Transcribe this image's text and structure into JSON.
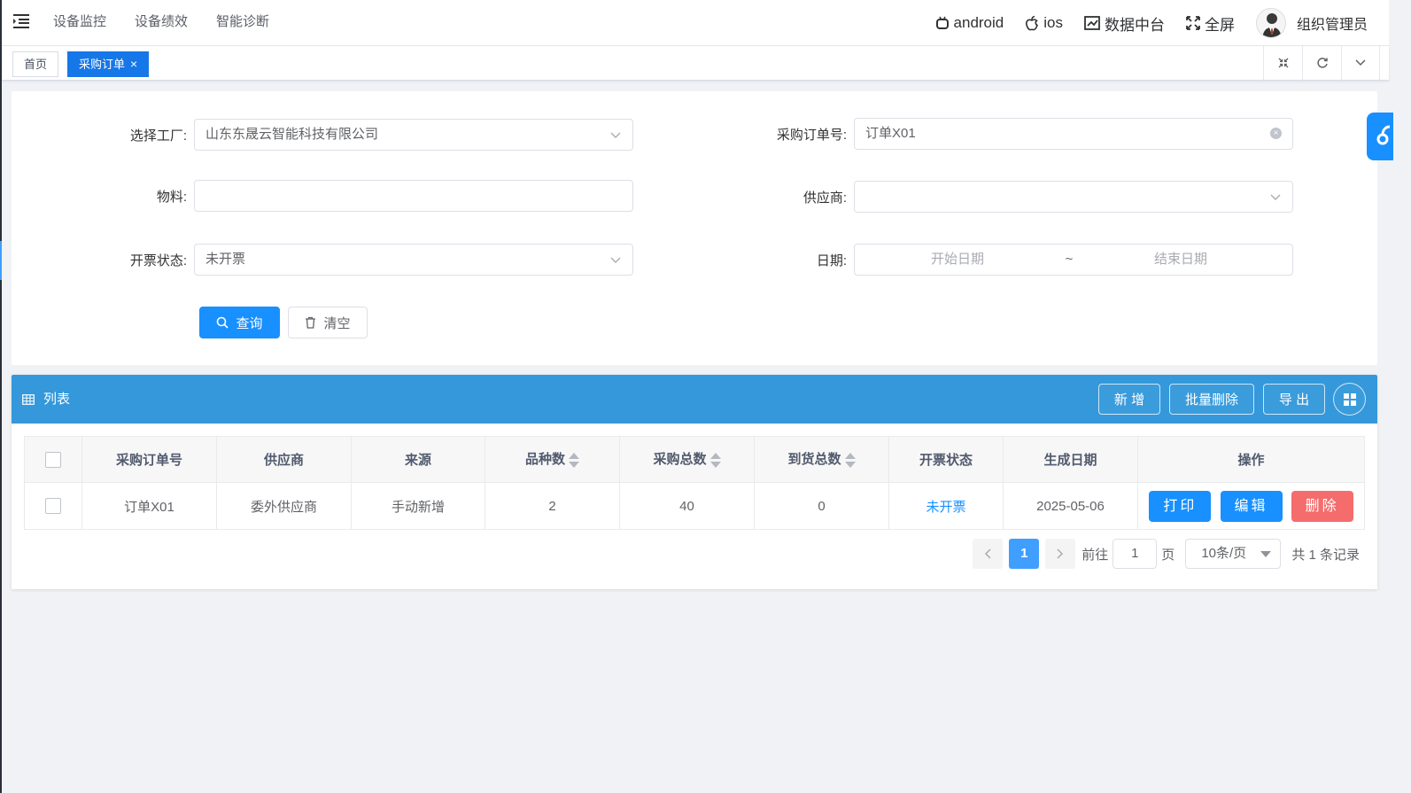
{
  "header": {
    "nav_items": [
      "设备监控",
      "设备绩效",
      "智能诊断"
    ],
    "right_menu": {
      "android": "android",
      "ios": "ios",
      "data_center": "数据中台",
      "fullscreen": "全屏",
      "user_name": "组织管理员"
    }
  },
  "tags": {
    "home": "首页",
    "active": "采购订单",
    "close": "×"
  },
  "filters": {
    "factory_label": "选择工厂:",
    "factory_value": "山东东晟云智能科技有限公司",
    "order_no_label": "采购订单号:",
    "order_no_value": "订单X01",
    "material_label": "物料:",
    "material_value": "",
    "supplier_label": "供应商:",
    "supplier_value": "",
    "invoice_label": "开票状态:",
    "invoice_value": "未开票",
    "date_label": "日期:",
    "date_start_placeholder": "开始日期",
    "date_sep": "~",
    "date_end_placeholder": "结束日期",
    "search_button": "查询",
    "clear_button": "清空"
  },
  "list": {
    "title": "列表",
    "buttons": {
      "add": "新 增",
      "batch_delete": "批量删除",
      "export": "导 出"
    },
    "columns": [
      "采购订单号",
      "供应商",
      "来源",
      "品种数",
      "采购总数",
      "到货总数",
      "开票状态",
      "生成日期",
      "操作"
    ],
    "rows": [
      {
        "order_no": "订单X01",
        "supplier": "委外供应商",
        "source": "手动新增",
        "variety": "2",
        "purchase_total": "40",
        "arrival_total": "0",
        "invoice_status": "未开票",
        "created": "2025-05-06",
        "actions": {
          "print": "打印",
          "edit": "编辑",
          "delete": "删除"
        }
      }
    ]
  },
  "pagination": {
    "current_page": "1",
    "goto_label": "前往",
    "goto_value": "1",
    "page_suffix": "页",
    "page_size": "10条/页",
    "total": "共 1 条记录"
  },
  "colors": {
    "accent": "#1890ff",
    "list_header": "#3498db",
    "danger": "#f56c6c",
    "active_tag": "#1677e8"
  }
}
